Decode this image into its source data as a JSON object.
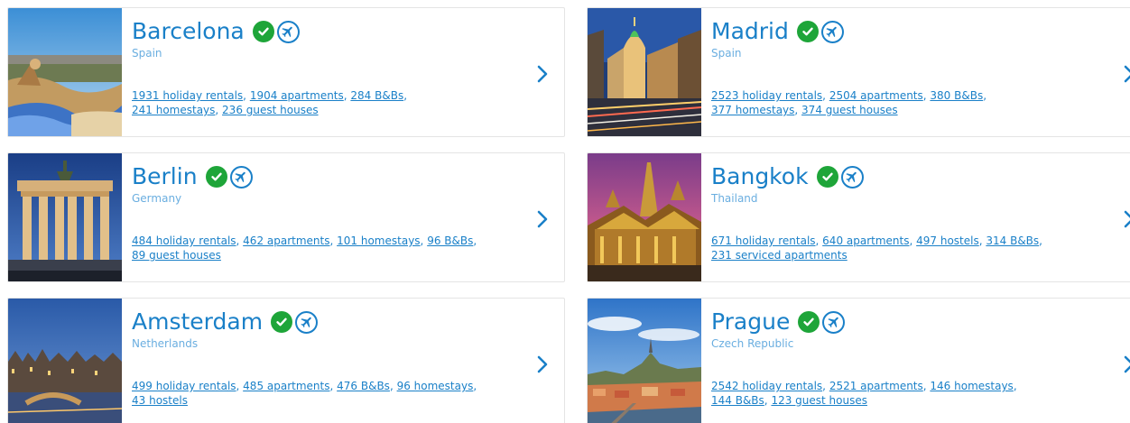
{
  "cards": [
    {
      "city": "Barcelona",
      "country": "Spain",
      "line1": [
        "1931 holiday rentals",
        "1904 apartments",
        "284 B&Bs"
      ],
      "line2": [
        "241 homestays",
        "236 guest houses"
      ]
    },
    {
      "city": "Madrid",
      "country": "Spain",
      "line1": [
        "2523 holiday rentals",
        "2504 apartments",
        "380 B&Bs"
      ],
      "line2": [
        "377 homestays",
        "374 guest houses"
      ]
    },
    {
      "city": "Berlin",
      "country": "Germany",
      "line1": [
        "484 holiday rentals",
        "462 apartments",
        "101 homestays",
        "96 B&Bs"
      ],
      "line2": [
        "89 guest houses"
      ]
    },
    {
      "city": "Bangkok",
      "country": "Thailand",
      "line1": [
        "671 holiday rentals",
        "640 apartments",
        "497 hostels",
        "314 B&Bs"
      ],
      "line2": [
        "231 serviced apartments"
      ]
    },
    {
      "city": "Amsterdam",
      "country": "Netherlands",
      "line1": [
        "499 holiday rentals",
        "485 apartments",
        "476 B&Bs",
        "96 homestays"
      ],
      "line2": [
        "43 hostels"
      ]
    },
    {
      "city": "Prague",
      "country": "Czech Republic",
      "line1": [
        "2542 holiday rentals",
        "2521 apartments",
        "146 homestays"
      ],
      "line2": [
        "144 B&Bs",
        "123 guest houses"
      ]
    }
  ],
  "icons": {
    "verified": "checkmark-circle-icon",
    "airport": "airplane-circle-icon",
    "next": "chevron-right-icon"
  },
  "colors": {
    "link_blue": "#1a80c8",
    "country_blue": "#6aaee0",
    "verified_green": "#1ea539",
    "card_border": "#e4e4e4"
  }
}
